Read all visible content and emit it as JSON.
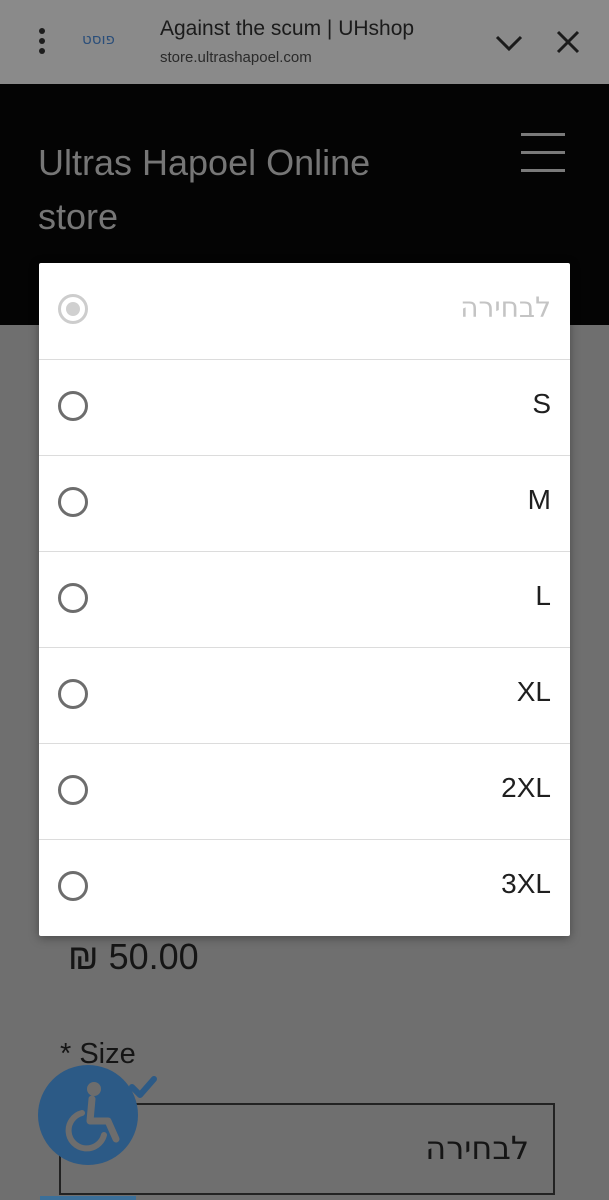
{
  "browser": {
    "origin_badge": "פוסט",
    "page_title": "Against the scum | UHshop",
    "url": "store.ultrashapoel.com",
    "icons": [
      "menu-kebab-icon",
      "chevron-down-icon",
      "close-icon"
    ]
  },
  "header": {
    "site_title": "Ultras Hapoel Online store",
    "icons": [
      "hamburger-menu-icon"
    ]
  },
  "product": {
    "price": "₪ 50.00",
    "size_label": "* Size",
    "size_select_value": "לבחירה"
  },
  "accessibility_widget": {
    "icons": [
      "wheelchair-icon",
      "checkmark-icon"
    ],
    "color": "#2c5a86"
  },
  "size_dropdown": {
    "selected_index": 0,
    "options": [
      {
        "label": "לבחירה",
        "disabled": true,
        "checked": true
      },
      {
        "label": "S",
        "disabled": false,
        "checked": false
      },
      {
        "label": "M",
        "disabled": false,
        "checked": false
      },
      {
        "label": "L",
        "disabled": false,
        "checked": false
      },
      {
        "label": "XL",
        "disabled": false,
        "checked": false
      },
      {
        "label": "2XL",
        "disabled": false,
        "checked": false
      },
      {
        "label": "3XL",
        "disabled": false,
        "checked": false
      }
    ]
  }
}
